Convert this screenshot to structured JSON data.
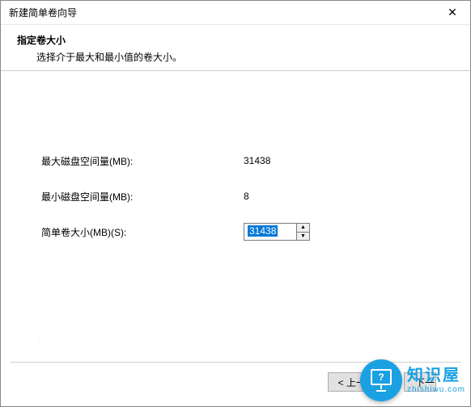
{
  "window": {
    "title": "新建简单卷向导"
  },
  "heading": {
    "title": "指定卷大小",
    "subtitle": "选择介于最大和最小值的卷大小。"
  },
  "fields": {
    "max_label": "最大磁盘空间量(MB):",
    "max_value": "31438",
    "min_label": "最小磁盘空间量(MB):",
    "min_value": "8",
    "size_label": "简单卷大小(MB)(S):",
    "size_value": "31438"
  },
  "buttons": {
    "back": "< 上一步(B)",
    "next": "下一"
  },
  "watermark": {
    "name": "知识屋",
    "url": "zhishiwu.com"
  }
}
